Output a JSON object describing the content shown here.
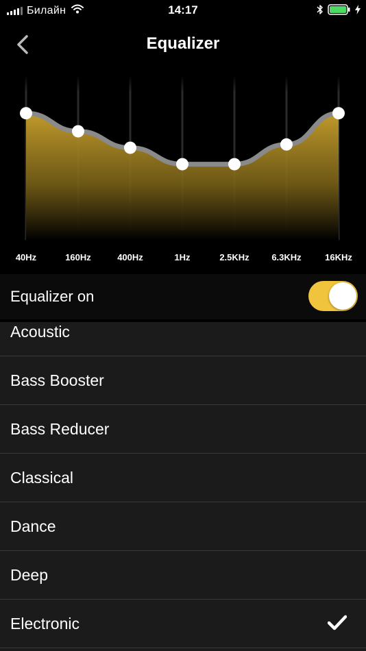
{
  "status_bar": {
    "carrier": "Билайн",
    "time": "14:17",
    "battery_color": "#4cd964"
  },
  "nav": {
    "title": "Equalizer",
    "back_icon": "chevron-left-icon"
  },
  "equalizer": {
    "accent": "#f0c43d",
    "bands": [
      {
        "label": "40Hz",
        "level": 0.77
      },
      {
        "label": "160Hz",
        "level": 0.66
      },
      {
        "label": "400Hz",
        "level": 0.56
      },
      {
        "label": "1Hz",
        "level": 0.46
      },
      {
        "label": "2.5KHz",
        "level": 0.46
      },
      {
        "label": "6.3KHz",
        "level": 0.58
      },
      {
        "label": "16KHz",
        "level": 0.77
      }
    ]
  },
  "toggle_row": {
    "label": "Equalizer on",
    "on": true
  },
  "presets": {
    "items": [
      {
        "label": "Acoustic",
        "selected": false
      },
      {
        "label": "Bass Booster",
        "selected": false
      },
      {
        "label": "Bass Reducer",
        "selected": false
      },
      {
        "label": "Classical",
        "selected": false
      },
      {
        "label": "Dance",
        "selected": false
      },
      {
        "label": "Deep",
        "selected": false
      },
      {
        "label": "Electronic",
        "selected": true
      }
    ]
  }
}
